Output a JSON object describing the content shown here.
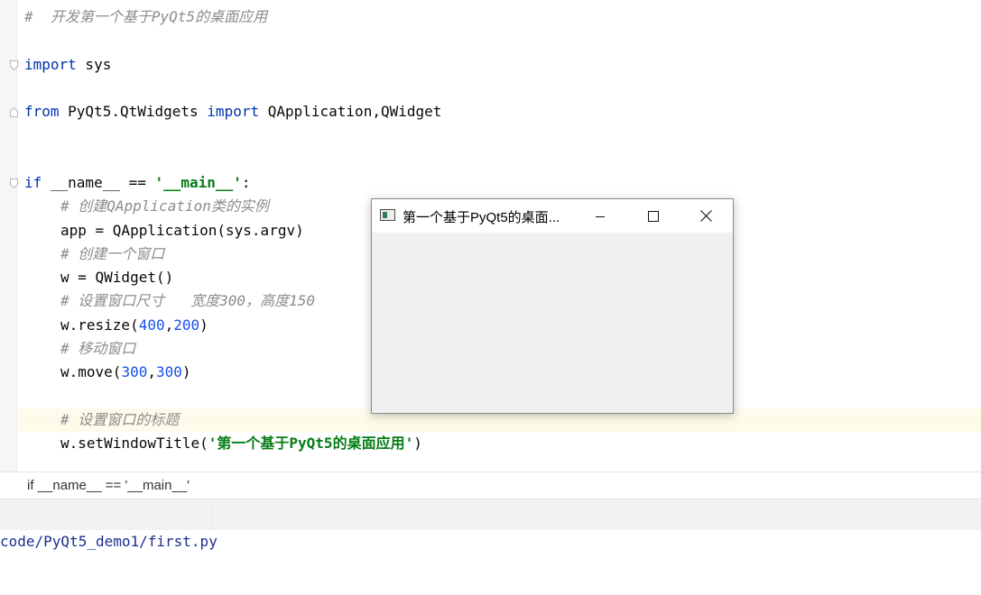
{
  "editor": {
    "comment_top": "#  开发第一个基于PyQt5的桌面应用",
    "import_sys": {
      "kw": "import",
      "rest": " sys"
    },
    "from_line": {
      "kw1": "from",
      "mid": " PyQt5.QtWidgets ",
      "kw2": "import",
      "rest": " QApplication,QWidget"
    },
    "if_line": {
      "kw": "if",
      "mid": " __name__ == ",
      "str": "'__main__'",
      "end": ":"
    },
    "c1": "# 创建QApplication类的实例",
    "l_app": "app = QApplication(sys.argv)",
    "c2": "# 创建一个窗口",
    "l_w": "w = QWidget()",
    "c3": "# 设置窗口尺寸   宽度300，高度150",
    "resize": {
      "pre": "w.resize(",
      "n1": "400",
      "comma": ",",
      "n2": "200",
      "post": ")"
    },
    "c4": "# 移动窗口",
    "move": {
      "pre": "w.move(",
      "n1": "300",
      "comma": ",",
      "n2": "300",
      "post": ")"
    },
    "c5": "# 设置窗口的标题",
    "title_line": {
      "pre": "w.setWindowTitle(",
      "str": "'第一个基于PyQt5的桌面应用'",
      "post": ")"
    }
  },
  "breadcrumb": "if __name__ == '__main__'",
  "console": {
    "path": "code/PyQt5_demo1/first.py"
  },
  "window": {
    "title": "第一个基于PyQt5的桌面...",
    "icons": {
      "app": "app-window-icon",
      "min": "minimize-icon",
      "max": "maximize-icon",
      "close": "close-icon"
    }
  },
  "colors": {
    "keyword": "#0033b3",
    "number": "#1750eb",
    "string": "#067d17",
    "comment": "#8c8c8c"
  }
}
